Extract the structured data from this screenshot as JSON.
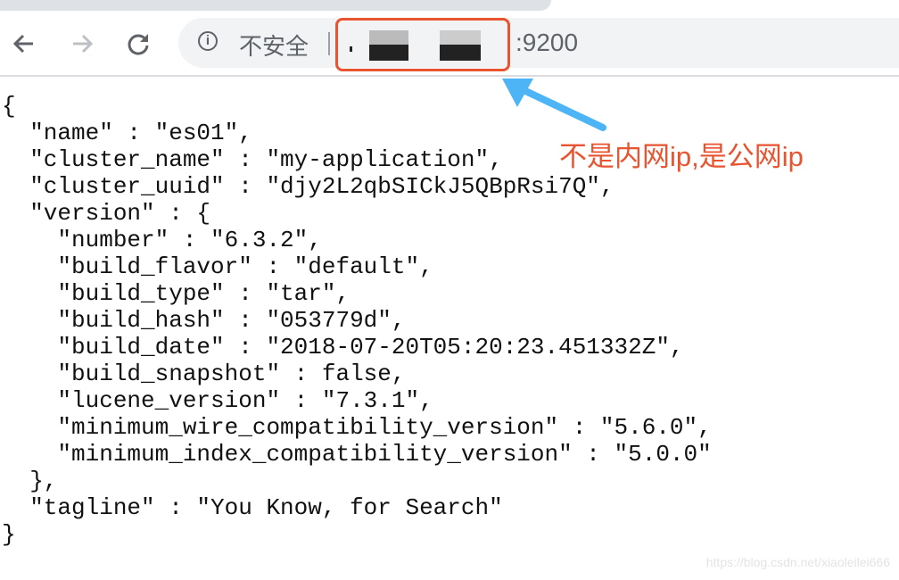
{
  "browser": {
    "security_label": "不安全",
    "url_port": ":9200",
    "icons": [
      "back-arrow-icon",
      "forward-arrow-icon",
      "reload-icon",
      "info-icon"
    ]
  },
  "response_lines": [
    "{",
    "  \"name\" : \"es01\",",
    "  \"cluster_name\" : \"my-application\",",
    "  \"cluster_uuid\" : \"djy2L2qbSICkJ5QBpRsi7Q\",",
    "  \"version\" : {",
    "    \"number\" : \"6.3.2\",",
    "    \"build_flavor\" : \"default\",",
    "    \"build_type\" : \"tar\",",
    "    \"build_hash\" : \"053779d\",",
    "    \"build_date\" : \"2018-07-20T05:20:23.451332Z\",",
    "    \"build_snapshot\" : false,",
    "    \"lucene_version\" : \"7.3.1\",",
    "    \"minimum_wire_compatibility_version\" : \"5.6.0\",",
    "    \"minimum_index_compatibility_version\" : \"5.0.0\"",
    "  },",
    "  \"tagline\" : \"You Know, for Search\"",
    "}"
  ],
  "annotation": {
    "text": "不是内网ip,是公网ip",
    "color": "#e8542f",
    "arrow_color": "#4db5f5"
  },
  "watermark": "https://blog.csdn.net/xiaoleilei666"
}
